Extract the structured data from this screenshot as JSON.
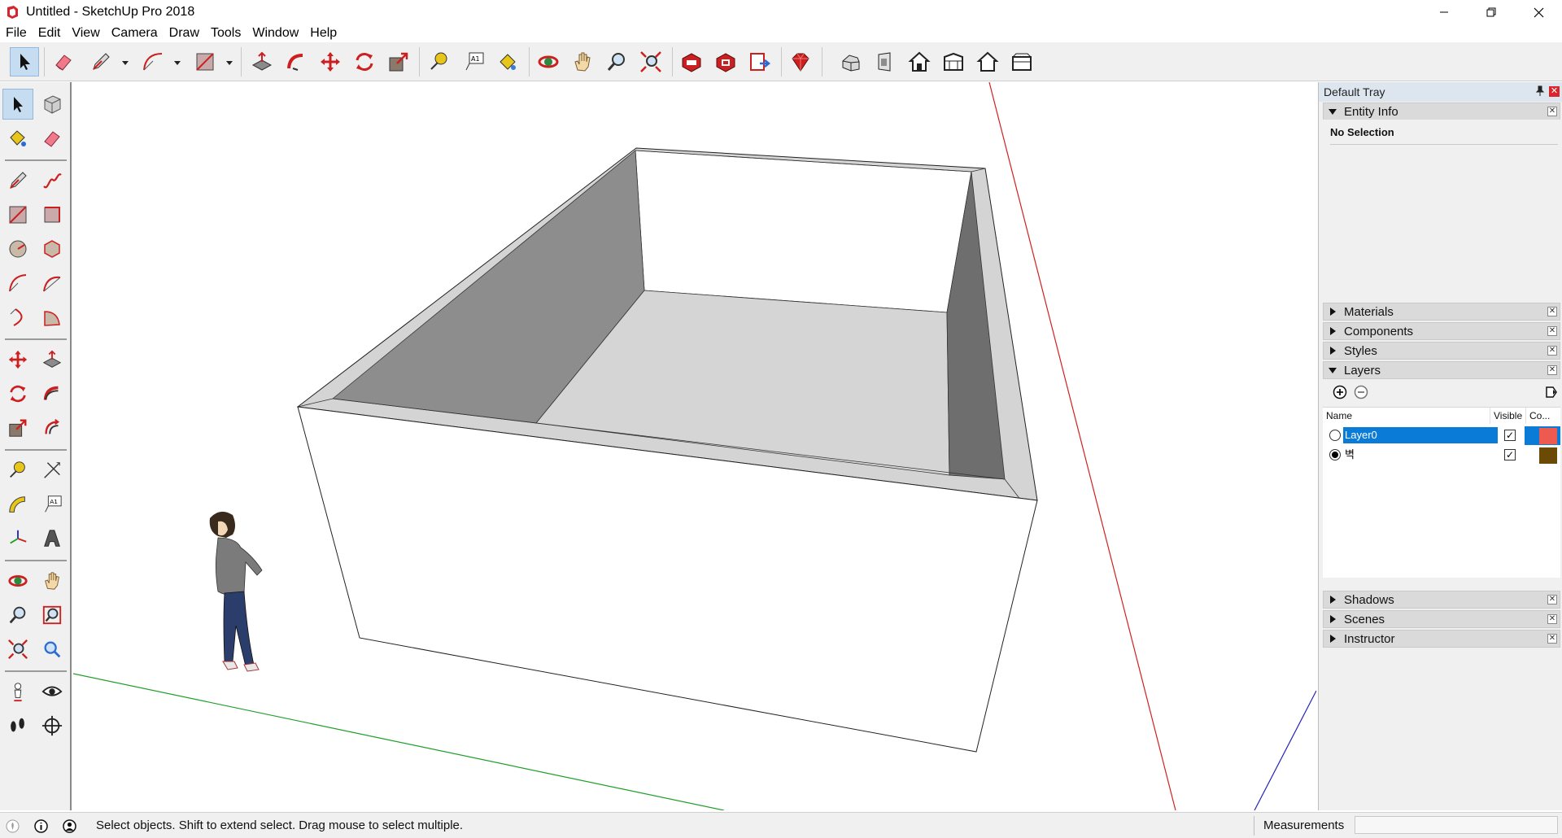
{
  "window": {
    "title": "Untitled - SketchUp Pro 2018"
  },
  "menu": [
    "File",
    "Edit",
    "View",
    "Camera",
    "Draw",
    "Tools",
    "Window",
    "Help"
  ],
  "toolbar": {
    "tools": [
      "select",
      "eraser",
      "pencil",
      "arc",
      "rectangle",
      "push-pull",
      "follow-me",
      "move",
      "rotate",
      "scale",
      "tape-measure",
      "text",
      "paint-bucket",
      "orbit",
      "pan",
      "zoom",
      "zoom-extents",
      "3d-warehouse",
      "extension-warehouse",
      "send-to-layout",
      "ruby-console",
      "iso-view",
      "front-view",
      "top-view",
      "right-view",
      "back-view",
      "left-view"
    ],
    "text_icon_label": "A1"
  },
  "tray": {
    "title": "Default Tray",
    "entity_info": {
      "label": "Entity Info",
      "status": "No Selection"
    },
    "panels_mid": [
      "Materials",
      "Components",
      "Styles"
    ],
    "layers": {
      "label": "Layers",
      "columns": {
        "name": "Name",
        "visible": "Visible",
        "color": "Co..."
      },
      "rows": [
        {
          "name": "Layer0",
          "active": false,
          "selected": true,
          "visible": true,
          "color": "#ef5a50"
        },
        {
          "name": "벽",
          "active": true,
          "selected": false,
          "visible": true,
          "color": "#6b4a06"
        }
      ]
    },
    "panels_bottom": [
      "Shadows",
      "Scenes",
      "Instructor"
    ]
  },
  "status": {
    "message": "Select objects. Shift to extend select. Drag mouse to select multiple.",
    "measurements_label": "Measurements",
    "measurements_value": ""
  },
  "colors": {
    "axis_red": "#d22020",
    "axis_green": "#1f9e2a",
    "axis_blue": "#2323b8",
    "selection_blue": "#0a7bd6",
    "tool_red": "#cc1f1f"
  }
}
